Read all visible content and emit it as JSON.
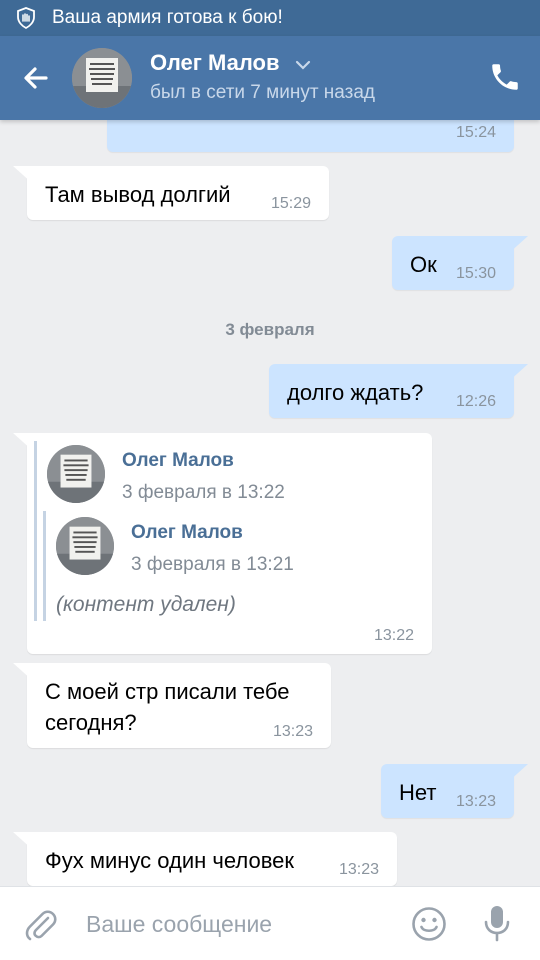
{
  "status_bar": {
    "notification_text": "Ваша армия готова к бою!"
  },
  "header": {
    "title": "Олег Малов",
    "subtitle": "был в сети 7 минут назад"
  },
  "messages": [
    {
      "direction": "out",
      "text": "",
      "time": "15:24"
    },
    {
      "direction": "in",
      "text": "Там вывод долгий",
      "time": "15:29"
    },
    {
      "direction": "out",
      "text": "Ок",
      "time": "15:30"
    },
    {
      "direction": "out",
      "text": "долго ждать?",
      "time": "12:26"
    },
    {
      "direction": "in",
      "time": "13:22",
      "forwarded": {
        "name": "Олег Малов",
        "date": "3 февраля в 13:22",
        "inner": {
          "name": "Олег Малов",
          "date": "3 февраля в 13:21",
          "content": "(контент удален)"
        }
      }
    },
    {
      "direction": "in",
      "text_line1": "С моей стр писали тебе",
      "text_line2": "сегодня?",
      "time": "13:23"
    },
    {
      "direction": "out",
      "text": "Нет",
      "time": "13:23"
    },
    {
      "direction": "in",
      "text": "Фух минус один человек",
      "time": "13:23"
    }
  ],
  "date_separator": "3 февраля",
  "composer": {
    "placeholder": "Ваше сообщение"
  },
  "icons": {
    "status": "notification-hand-icon",
    "back": "arrow-left-icon",
    "dropdown": "chevron-down-icon",
    "call": "phone-icon",
    "attach": "paperclip-icon",
    "emoji": "smiley-icon",
    "voice": "microphone-icon"
  },
  "colors": {
    "header": "#4a76a8",
    "status_bar": "#3f6a96",
    "outgoing_bubble": "#cce4ff",
    "incoming_bubble": "#ffffff",
    "background": "#edeef0",
    "link_name": "#4a6f96"
  }
}
